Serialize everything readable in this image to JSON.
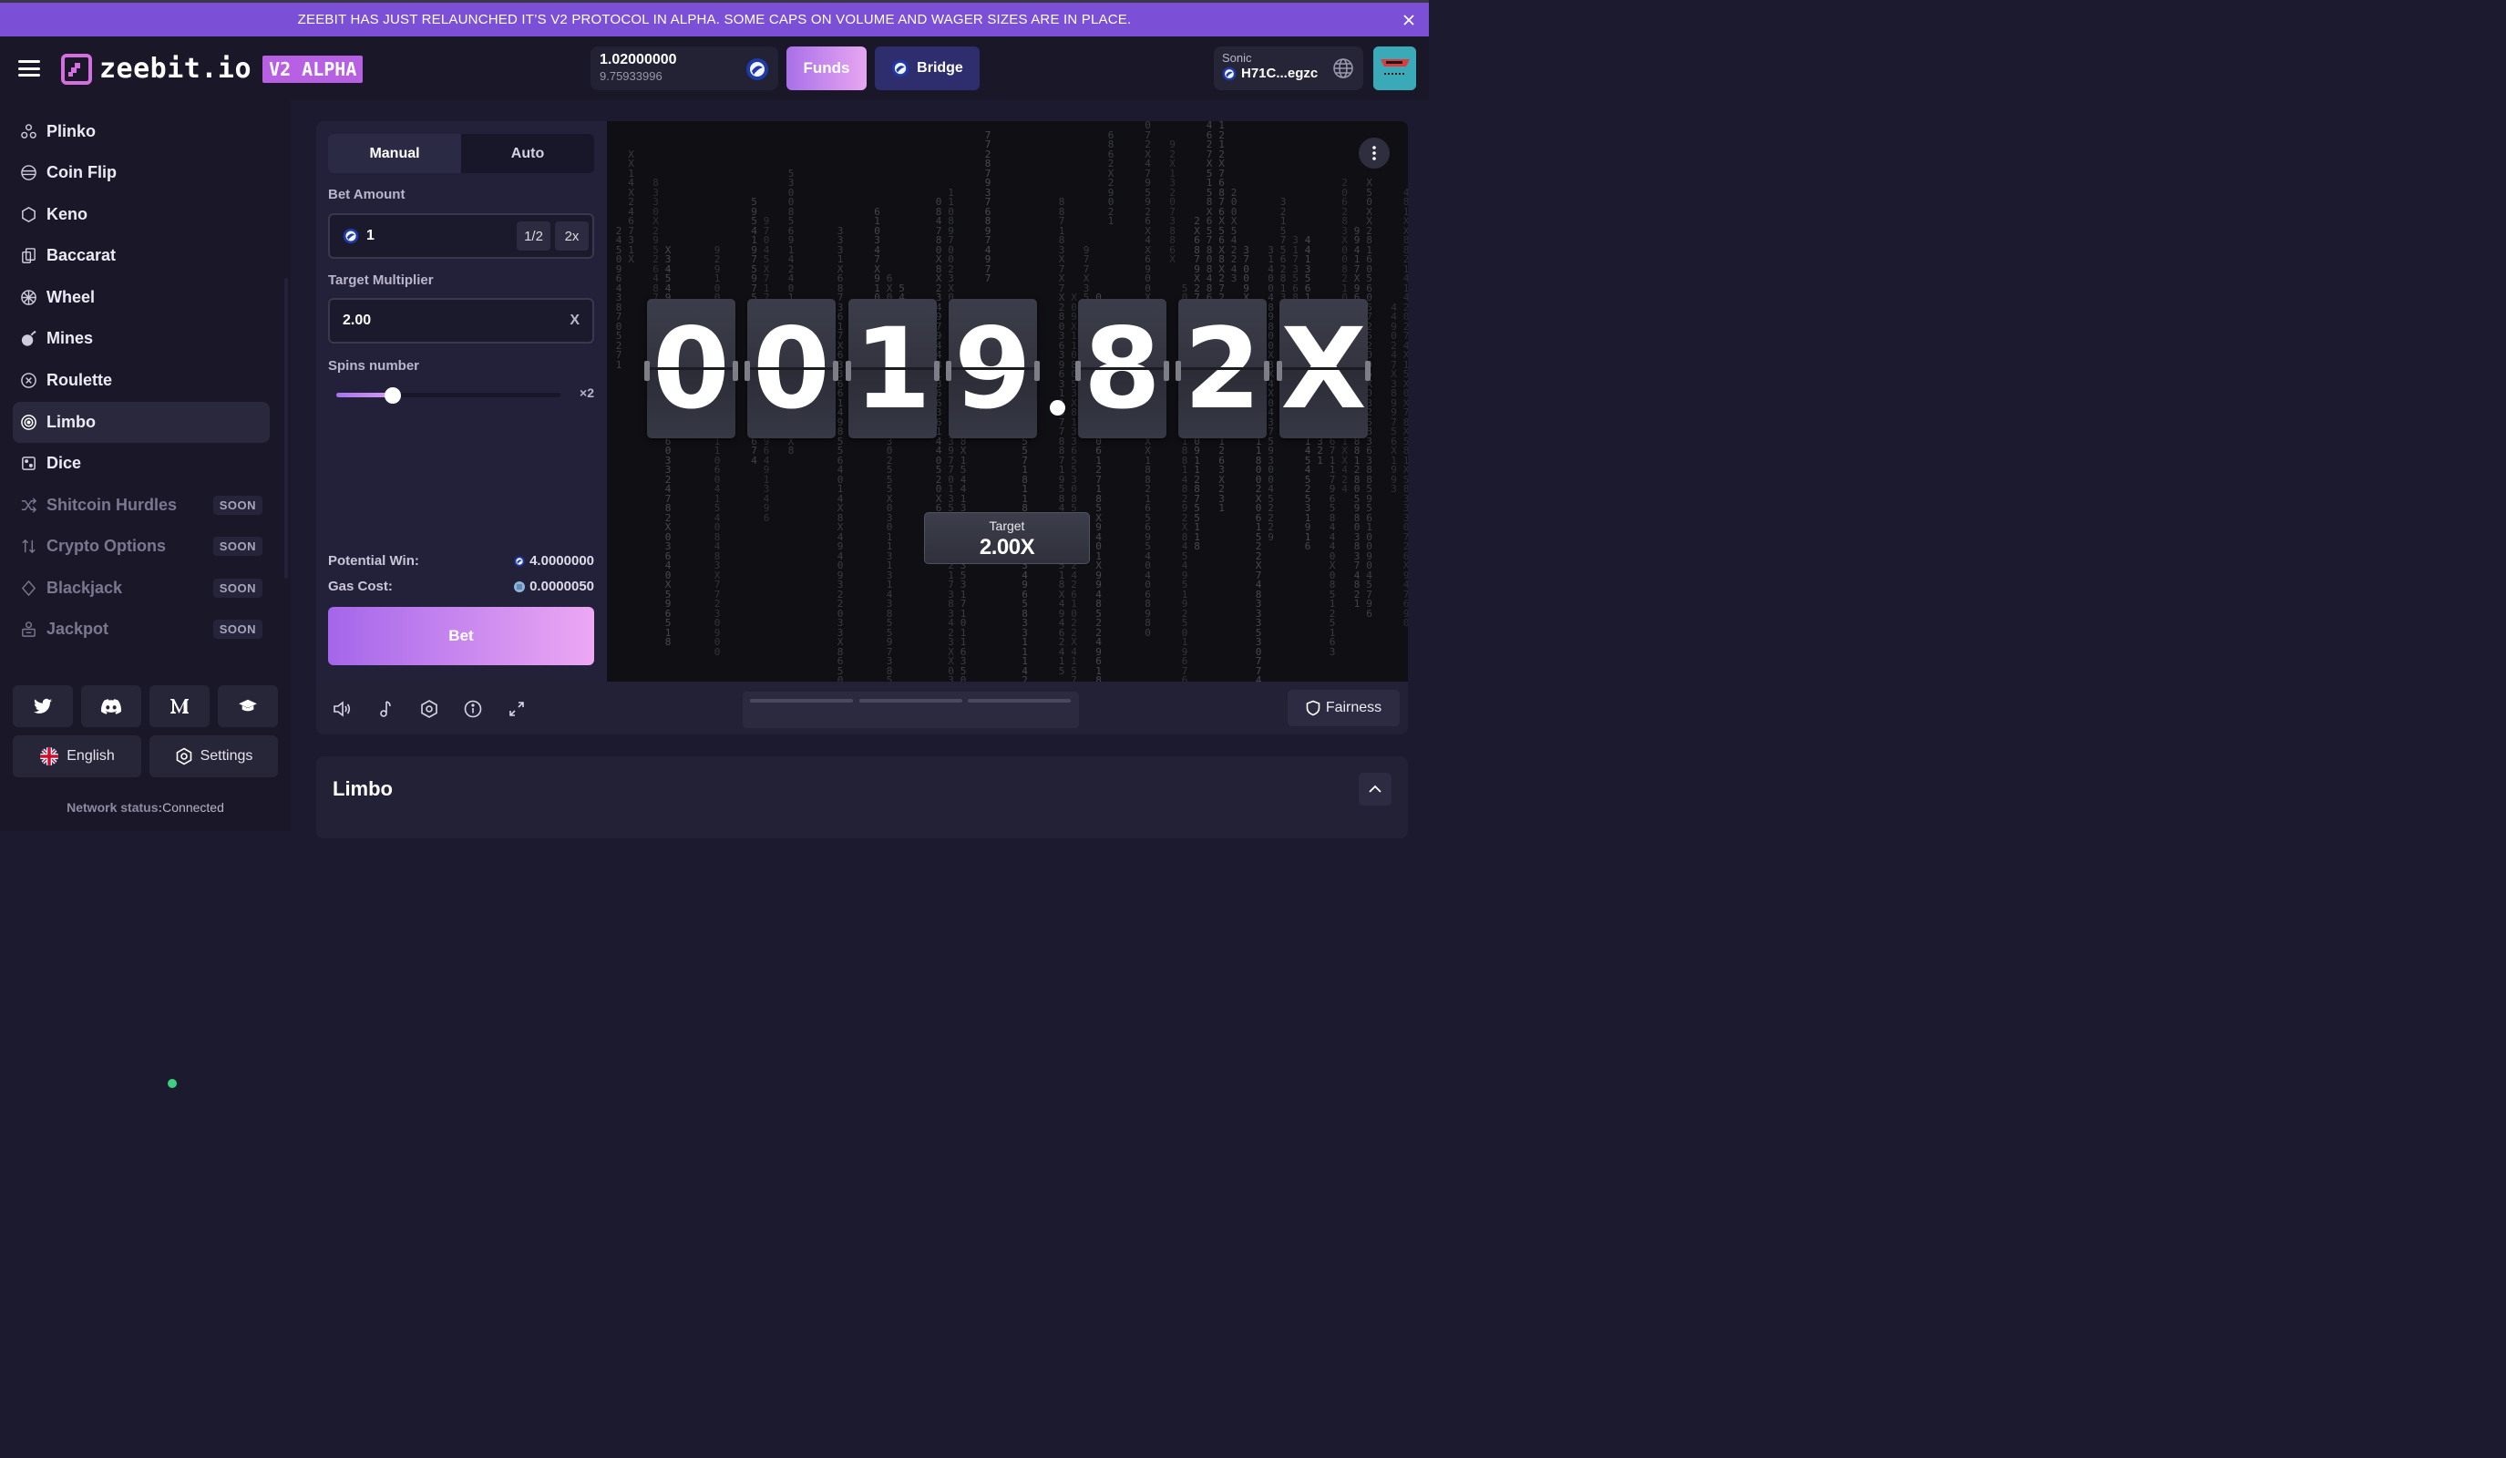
{
  "banner": {
    "text": "ZEEBIT HAS JUST RELAUNCHED IT’S V2 PROTOCOL IN ALPHA. SOME CAPS ON VOLUME AND WAGER SIZES ARE IN PLACE."
  },
  "header": {
    "logo_text": "zeebit.io",
    "logo_badge": "V2 ALPHA",
    "balance": "1.02000000",
    "balance_usd": "9.75933996",
    "funds_label": "Funds",
    "bridge_label": "Bridge",
    "wallet_network": "Sonic",
    "wallet_address": "H71C...egzc"
  },
  "sidebar": {
    "items": [
      {
        "label": "Plinko",
        "icon": "plinko-icon"
      },
      {
        "label": "Coin Flip",
        "icon": "coin-icon"
      },
      {
        "label": "Keno",
        "icon": "hexagon-icon"
      },
      {
        "label": "Baccarat",
        "icon": "cards-icon"
      },
      {
        "label": "Wheel",
        "icon": "wheel-icon"
      },
      {
        "label": "Mines",
        "icon": "bomb-icon"
      },
      {
        "label": "Roulette",
        "icon": "roulette-icon"
      },
      {
        "label": "Limbo",
        "icon": "target-icon"
      },
      {
        "label": "Dice",
        "icon": "dice-icon"
      },
      {
        "label": "Shitcoin Hurdles",
        "icon": "shuffle-icon",
        "badge": "SOON"
      },
      {
        "label": "Crypto Options",
        "icon": "arrows-updown-icon",
        "badge": "SOON"
      },
      {
        "label": "Blackjack",
        "icon": "diamond-icon",
        "badge": "SOON"
      },
      {
        "label": "Jackpot",
        "icon": "jackpot-icon",
        "badge": "SOON"
      }
    ],
    "language_label": "English",
    "settings_label": "Settings",
    "network_label": "Network status:",
    "network_value": "Connected"
  },
  "controls": {
    "tab_manual": "Manual",
    "tab_auto": "Auto",
    "bet_amount_label": "Bet Amount",
    "bet_amount_value": "1",
    "half_label": "1/2",
    "double_label": "2x",
    "target_label": "Target Multiplier",
    "target_value": "2.00",
    "target_clear": "X",
    "spins_label": "Spins number",
    "spins_value": "×2",
    "spins_fraction": 0.25,
    "potential_win_label": "Potential Win:",
    "potential_win_value": "4.0000000",
    "gas_cost_label": "Gas Cost:",
    "gas_cost_value": "0.0000050",
    "bet_label": "Bet"
  },
  "game": {
    "result_digits": [
      "0",
      "0",
      "1",
      "9",
      "8",
      "2",
      "X"
    ],
    "target_caption": "Target",
    "target_value": "2.00X"
  },
  "bottom": {
    "fairness_label": "Fairness"
  },
  "info": {
    "title": "Limbo"
  },
  "colors": {
    "accent": "#a466ea",
    "accent_light": "#eca8f3",
    "banner": "#7b4fd6",
    "bridge": "#2e2d6e",
    "connected": "#3fcf7e"
  }
}
